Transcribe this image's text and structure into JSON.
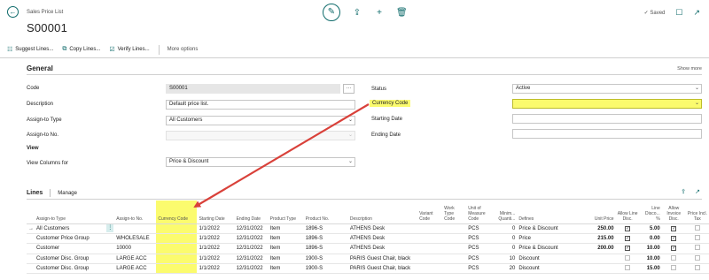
{
  "header": {
    "breadcrumb": "Sales Price List",
    "title": "S00001",
    "saved_label": "Saved"
  },
  "actions": {
    "suggest": "Suggest Lines...",
    "copy": "Copy Lines...",
    "verify": "Verify Lines...",
    "more": "More options"
  },
  "general": {
    "title": "General",
    "show_more": "Show more",
    "code_label": "Code",
    "code_value": "S00001",
    "description_label": "Description",
    "description_value": "Default price list.",
    "assign_type_label": "Assign-to Type",
    "assign_type_value": "All Customers",
    "assign_no_label": "Assign-to No.",
    "assign_no_value": "",
    "view_heading": "View",
    "view_columns_label": "View Columns for",
    "view_columns_value": "Price & Discount",
    "status_label": "Status",
    "status_value": "Active",
    "currency_label": "Currency Code",
    "currency_value": "",
    "starting_date_label": "Starting Date",
    "starting_date_value": "",
    "ending_date_label": "Ending Date",
    "ending_date_value": ""
  },
  "lines": {
    "tab": "Lines",
    "manage": "Manage",
    "columns": {
      "assign_type": "Assign-to Type",
      "assign_no": "Assign-to No.",
      "currency": "Currency Code",
      "start": "Starting Date",
      "end": "Ending Date",
      "ptype": "Product Type",
      "pno": "Product No.",
      "desc": "Description",
      "variant": "Variant Code",
      "worktype": "Work Type Code",
      "uom": "Unit of Measure Code",
      "minq": "Minim... Quanti...",
      "defines": "Defines",
      "price": "Unit Price",
      "allowline": "Allow Line Disc.",
      "linedisc": "Line Disco... %",
      "allowinv": "Allow Invoice Disc.",
      "priceincl": "Price Incl. Tax"
    },
    "rows": [
      {
        "assign_type": "All Customers",
        "assign_no": "",
        "currency": "",
        "start": "1/1/2022",
        "end": "12/31/2022",
        "ptype": "Item",
        "pno": "1896-S",
        "desc": "ATHENS Desk",
        "uom": "PCS",
        "minq": "0",
        "defines": "Price & Discount",
        "price": "250.00",
        "allowline": true,
        "linedisc": "5.00",
        "allowinv": true,
        "priceincl": false
      },
      {
        "assign_type": "Customer Price Group",
        "assign_no": "WHOLESALE",
        "currency": "",
        "start": "1/1/2022",
        "end": "12/31/2022",
        "ptype": "Item",
        "pno": "1896-S",
        "desc": "ATHENS Desk",
        "uom": "PCS",
        "minq": "0",
        "defines": "Price",
        "price": "215.00",
        "allowline": true,
        "linedisc": "0.00",
        "allowinv": true,
        "priceincl": false
      },
      {
        "assign_type": "Customer",
        "assign_no": "10000",
        "currency": "",
        "start": "1/1/2022",
        "end": "12/31/2022",
        "ptype": "Item",
        "pno": "1896-S",
        "desc": "ATHENS Desk",
        "uom": "PCS",
        "minq": "0",
        "defines": "Price & Discount",
        "price": "200.00",
        "allowline": true,
        "linedisc": "10.00",
        "allowinv": true,
        "priceincl": false
      },
      {
        "assign_type": "Customer Disc. Group",
        "assign_no": "LARGE ACC",
        "currency": "",
        "start": "1/1/2022",
        "end": "12/31/2022",
        "ptype": "Item",
        "pno": "1900-S",
        "desc": "PARIS Guest Chair, black",
        "uom": "PCS",
        "minq": "10",
        "defines": "Discount",
        "price": "",
        "allowline": false,
        "linedisc": "10.00",
        "allowinv": false,
        "priceincl": false
      },
      {
        "assign_type": "Customer Disc. Group",
        "assign_no": "LARGE ACC",
        "currency": "",
        "start": "1/1/2022",
        "end": "12/31/2022",
        "ptype": "Item",
        "pno": "1900-S",
        "desc": "PARIS Guest Chair, black",
        "uom": "PCS",
        "minq": "20",
        "defines": "Discount",
        "price": "",
        "allowline": false,
        "linedisc": "15.00",
        "allowinv": false,
        "priceincl": false
      }
    ]
  },
  "colors": {
    "accent": "#0f6b6b",
    "highlight": "#fbfb6e",
    "annotation_arrow": "#d9413a"
  }
}
